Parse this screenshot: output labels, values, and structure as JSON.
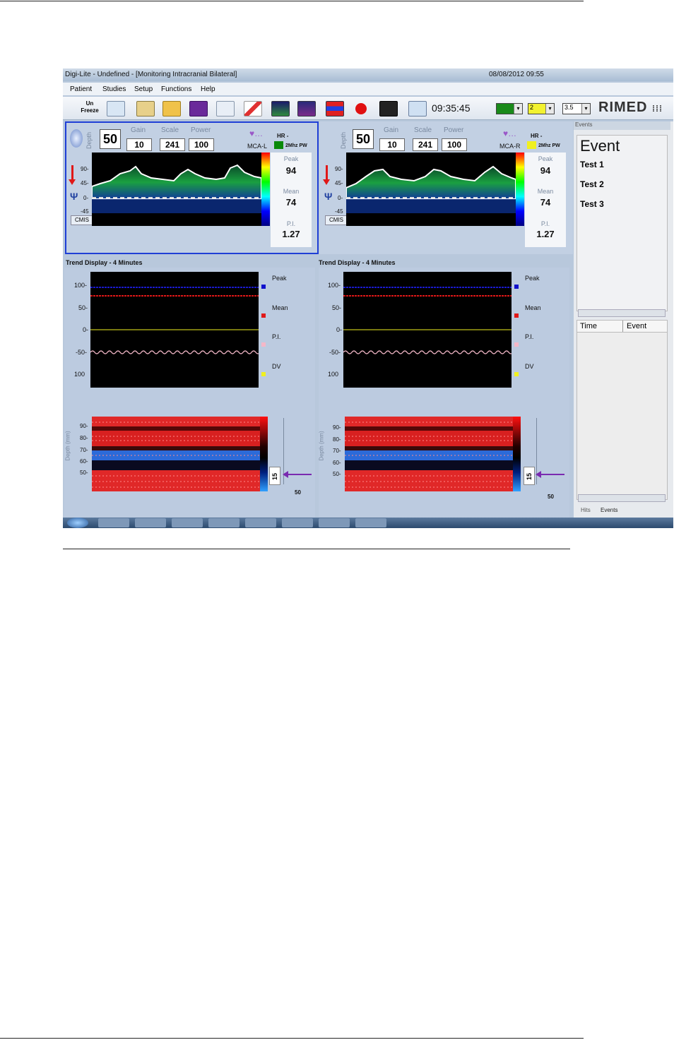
{
  "window": {
    "title": "Digi-Lite - Undefined - [Monitoring Intracranial Bilateral]",
    "datetime": "08/08/2012 09:55"
  },
  "menu": [
    "Patient",
    "Studies",
    "Setup",
    "Functions",
    "Help"
  ],
  "toolbar": {
    "freeze_top": "Un",
    "freeze_bottom": "Freeze",
    "clock": "09:35:45",
    "combo_gain": "2",
    "combo_scale": "3.5",
    "brand": "RIMED"
  },
  "colors": {
    "accent": "#1f3fd6",
    "peak": "#1010cc",
    "mean": "#e01818",
    "pi": "#f4b8c8",
    "dv": "#f0f020",
    "hr_left": "#0a8a0a",
    "hr_right": "#f0f020"
  },
  "left_probe": {
    "depth_label": "Depth",
    "depth": "50",
    "gain_label": "Gain",
    "gain": "10",
    "scale_label": "Scale",
    "scale": "241",
    "power_label": "Power",
    "power": "100",
    "hr": "HR -",
    "vessel": "MCA-L",
    "mode": "2Mhz PW",
    "cmis": "CMIS",
    "ticks": [
      "90-",
      "45-",
      "0-",
      "-45"
    ],
    "peak_label": "Peak",
    "peak": "94",
    "mean_label": "Mean",
    "mean": "74",
    "pi_label": "P.I.",
    "pi": "1.27"
  },
  "right_probe": {
    "depth_label": "Depth",
    "depth": "50",
    "gain_label": "Gain",
    "gain": "10",
    "scale_label": "Scale",
    "scale": "241",
    "power_label": "Power",
    "power": "100",
    "hr": "HR -",
    "vessel": "MCA-R",
    "mode": "2Mhz PW",
    "cmis": "CMIS",
    "ticks": [
      "90-",
      "45-",
      "0-",
      "-45"
    ],
    "peak_label": "Peak",
    "peak": "94",
    "mean_label": "Mean",
    "mean": "74",
    "pi_label": "P.I.",
    "pi": "1.27"
  },
  "trend_left": {
    "title": "Trend Display - 4 Minutes",
    "yticks": [
      "100-",
      "50-",
      "0-",
      "-50-",
      "100"
    ],
    "legend": [
      "Peak",
      "Mean",
      "P.I.",
      "DV"
    ],
    "depth_axis": "Depth (mm)",
    "depth_ticks": [
      "90-",
      "80-",
      "70-",
      "60-",
      "50-"
    ],
    "gate": "15",
    "marker": "50"
  },
  "trend_right": {
    "title": "Trend Display - 4 Minutes",
    "yticks": [
      "100-",
      "50-",
      "0-",
      "-50-",
      "100"
    ],
    "legend": [
      "Peak",
      "Mean",
      "P.I.",
      "DV"
    ],
    "depth_axis": "Depth (mm)",
    "depth_ticks": [
      "90-",
      "80-",
      "70-",
      "60-",
      "50-"
    ],
    "gate": "15",
    "marker": "50"
  },
  "events": {
    "header": "Events",
    "title": "Event",
    "items": [
      "Test 1",
      "Test 2",
      "Test 3"
    ],
    "col_time": "Time",
    "col_event": "Event",
    "tab_hits": "Hits",
    "tab_events": "Events"
  }
}
